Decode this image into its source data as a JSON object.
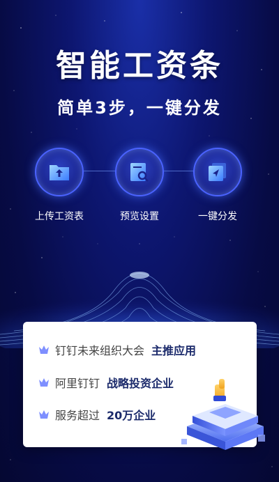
{
  "header": {
    "title": "智能工资条",
    "subtitle": "简单3步，一键分发"
  },
  "steps": [
    {
      "label": "上传工资表",
      "icon": "upload-folder-icon"
    },
    {
      "label": "预览设置",
      "icon": "preview-doc-icon"
    },
    {
      "label": "一键分发",
      "icon": "send-icon"
    }
  ],
  "features": [
    {
      "text": "钉钉未来组织大会",
      "highlight": "主推应用"
    },
    {
      "text": "阿里钉钉",
      "highlight": "战略投资企业"
    },
    {
      "text": "服务超过",
      "highlight": "20万企业"
    }
  ],
  "colors": {
    "background": "#0d1670",
    "accent": "#4b63ff",
    "crown": "#7e8fff",
    "highlight_text": "#1b2a6b"
  }
}
